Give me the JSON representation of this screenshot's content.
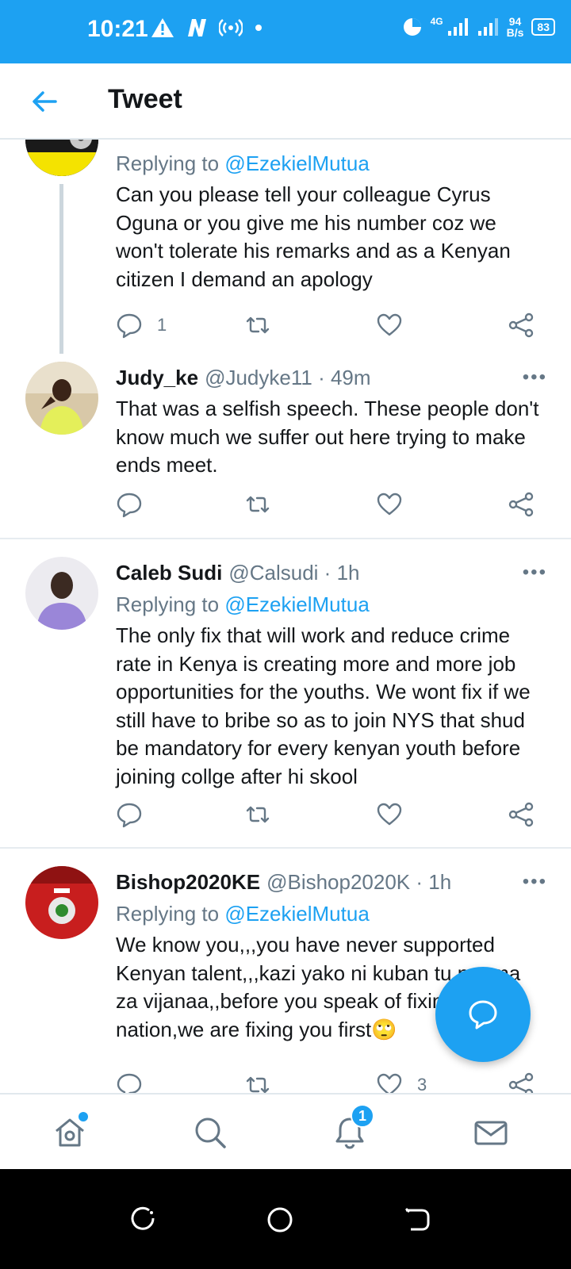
{
  "status_bar": {
    "time": "10:21",
    "network": "4G",
    "speed_value": "94",
    "speed_unit": "B/s",
    "battery": "83"
  },
  "header": {
    "title": "Tweet"
  },
  "tweets": [
    {
      "reply_prefix": "Replying to",
      "reply_mention": "@EzekielMutua",
      "text": "Can you please tell your colleague Cyrus Oguna or you give me his number coz  we won't tolerate his remarks and as a Kenyan citizen I demand an apology",
      "reply_count": "1"
    },
    {
      "name": "Judy_ke",
      "handle": "@Judyke11 · 49m",
      "text": "That was a selfish speech. These people don't know much we suffer out here trying to make ends meet."
    },
    {
      "name": "Caleb Sudi",
      "handle": "@Calsudi · 1h",
      "reply_prefix": "Replying to",
      "reply_mention": "@EzekielMutua",
      "text": "The only fix that will work and reduce crime rate in Kenya is creating more and more job opportunities for the youths. We wont fix if we still have to bribe so as to join NYS that shud be mandatory for every kenyan youth before joining collge after hi skool"
    },
    {
      "name": "Bishop2020KE",
      "handle": "@Bishop2020K · 1h",
      "reply_prefix": "Replying to",
      "reply_mention": "@EzekielMutua",
      "text": "We know you,,,you have never supported Kenyan talent,,,kazi yako ni kuban tu ngoma za vijanaa,,before you speak of fixing nation,we are fixing you first🙄",
      "like_count": "3"
    }
  ],
  "more_glyph": "•••",
  "bottom_nav": {
    "notification_badge": "1"
  },
  "colors": {
    "accent": "#1da1f2",
    "text": "#14171a",
    "muted": "#657786"
  }
}
